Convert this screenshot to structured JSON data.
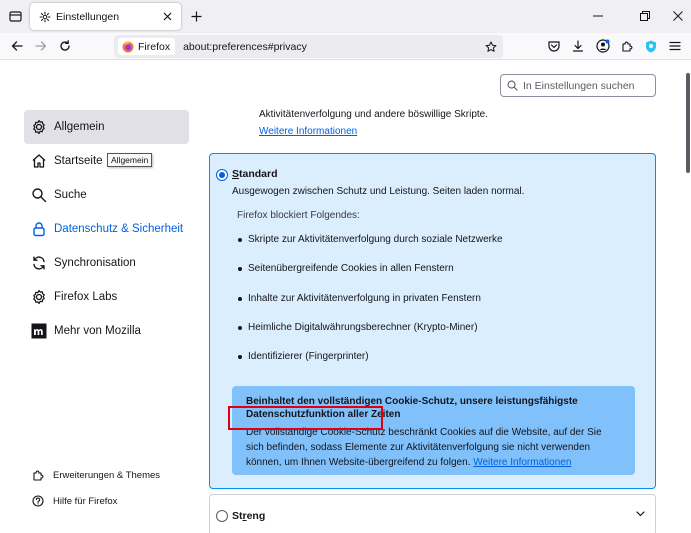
{
  "tab": {
    "title": "Einstellungen"
  },
  "urlbar": {
    "identity_label": "Firefox",
    "url": "about:preferences#privacy"
  },
  "search": {
    "placeholder": "In Einstellungen suchen"
  },
  "sidebar": {
    "items": [
      {
        "label": "Allgemein",
        "icon": "gear-icon"
      },
      {
        "label": "Startseite",
        "icon": "home-icon"
      },
      {
        "label": "Suche",
        "icon": "search-icon"
      },
      {
        "label": "Datenschutz & Sicherheit",
        "icon": "lock-icon"
      },
      {
        "label": "Synchronisation",
        "icon": "sync-icon"
      },
      {
        "label": "Firefox Labs",
        "icon": "labs-icon"
      },
      {
        "label": "Mehr von Mozilla",
        "icon": "mozilla-icon"
      }
    ],
    "tooltip": "Allgemein",
    "footer": [
      {
        "label": "Erweiterungen & Themes",
        "icon": "puzzle-icon"
      },
      {
        "label": "Hilfe für Firefox",
        "icon": "help-icon"
      }
    ]
  },
  "main": {
    "partial_text": "Aktivitätenverfolgung und andere böswillige Skripte.",
    "more_info_top": "Weitere Informationen",
    "standard": {
      "title_first": "S",
      "title_rest": "tandard",
      "description": "Ausgewogen zwischen Schutz und Leistung. Seiten laden normal.",
      "blocks_intro": "Firefox blockiert Folgendes:",
      "blocks": [
        "Skripte zur Aktivitätenverfolgung durch soziale Netzwerke",
        "Seitenübergreifende Cookies in allen Fenstern",
        "Inhalte zur Aktivitätenverfolgung in privaten Fenstern",
        "Heimliche Digitalwährungsberechner (Krypto-Miner)",
        "Identifizierer (Fingerprinter)"
      ],
      "info_title": "Beinhaltet den vollständigen Cookie-Schutz, unsere leistungsfähigste Datenschutzfunktion aller Zeiten",
      "info_text": "Der vollständige Cookie-Schutz beschränkt Cookies auf die Website, auf der Sie sich befinden, sodass Elemente zur Aktivitätenverfolgung sie nicht verwenden können, um Ihnen Website-übergreifend zu folgen.",
      "info_link": "Weitere Informationen"
    },
    "strict": {
      "title_first": "St",
      "title_underlined": "r",
      "title_rest": "eng"
    }
  },
  "colors": {
    "accent": "#0061e0",
    "card_bg": "#dbeefd",
    "info_bg": "#80c1fb",
    "highlight": "#e0000f"
  }
}
